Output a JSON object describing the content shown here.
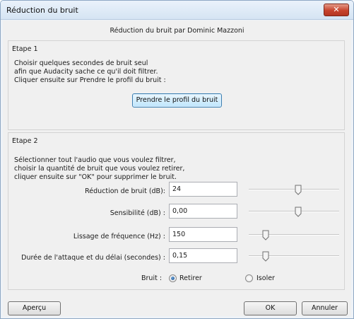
{
  "window": {
    "title": "Réduction du bruit",
    "close_symbol": "✕"
  },
  "header": {
    "subtitle": "Réduction du bruit par Dominic Mazzoni"
  },
  "step1": {
    "title": "Etape 1",
    "lines": [
      "Choisir quelques secondes de bruit seul",
      "afin que Audacity sache ce qu'il doit filtrer.",
      "Cliquer ensuite sur Prendre le profil du bruit :"
    ],
    "profile_button": "Prendre le profil du bruit"
  },
  "step2": {
    "title": "Etape 2",
    "lines": [
      "Sélectionner tout l'audio que vous voulez filtrer,",
      "choisir la quantité de bruit que vous voulez retirer,",
      "cliquer ensuite sur \"OK\" pour supprimer le bruit."
    ],
    "rows": [
      {
        "label": "Réduction de bruit (dB):",
        "value": "24",
        "slider_fraction": 0.55
      },
      {
        "label": "Sensibilité (dB) :",
        "value": "0,00",
        "slider_fraction": 0.55
      },
      {
        "label": "Lissage de fréquence (Hz) :",
        "value": "150",
        "slider_fraction": 0.19
      },
      {
        "label": "Durée de l'attaque et du délai (secondes) :",
        "value": "0,15",
        "slider_fraction": 0.19
      }
    ],
    "noise": {
      "label": "Bruit :",
      "options": [
        {
          "label": "Retirer",
          "selected": true
        },
        {
          "label": "Isoler",
          "selected": false
        }
      ]
    }
  },
  "buttons": {
    "preview": "Aperçu",
    "ok": "OK",
    "cancel": "Annuler"
  },
  "colors": {
    "accent": "#3c7fb1",
    "close": "#c7432d"
  }
}
